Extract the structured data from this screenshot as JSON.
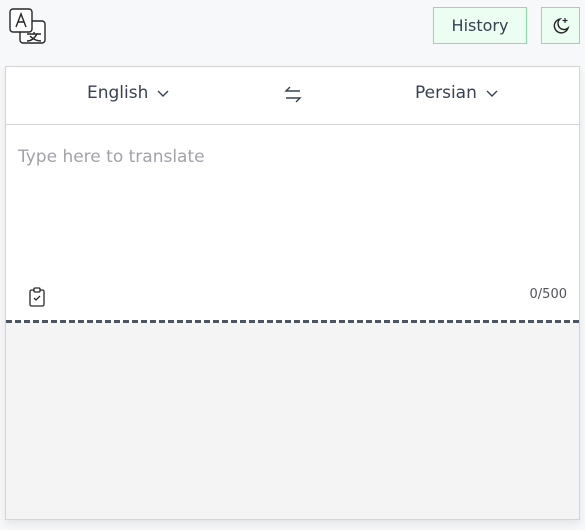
{
  "header": {
    "logo_icon": "translate-icon",
    "history_label": "History",
    "theme_icon": "moon-stars-icon"
  },
  "languages": {
    "source": "English",
    "target": "Persian",
    "swap_icon": "swap-arrows-icon"
  },
  "input": {
    "placeholder": "Type here to translate",
    "value": "",
    "char_count": "0/500",
    "paste_icon": "clipboard-check-icon"
  },
  "output": {
    "text": ""
  },
  "colors": {
    "accent_border": "#86e0a6",
    "accent_bg": "#ecfdf1",
    "divider": "#4b5563"
  }
}
